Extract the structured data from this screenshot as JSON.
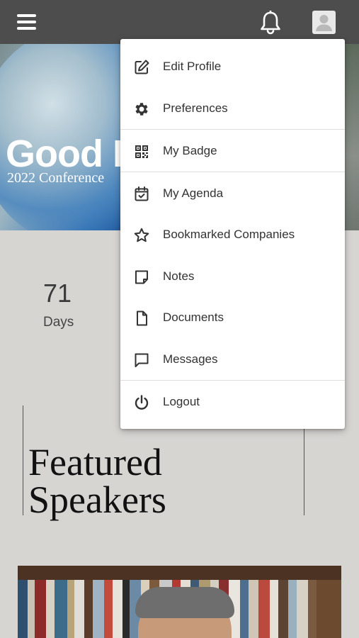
{
  "header": {
    "menu_icon": "hamburger-icon",
    "notification_icon": "bell-icon",
    "avatar_icon": "user-avatar-icon"
  },
  "hero": {
    "title": "Good F",
    "subtitle": "2022 Conference"
  },
  "countdown": {
    "value": "71",
    "unit": "Days"
  },
  "featured": {
    "title_line1": "Featured",
    "title_line2": "Speakers"
  },
  "dropdown": {
    "items": [
      {
        "label": "Edit Profile",
        "icon": "edit-icon"
      },
      {
        "label": "Preferences",
        "icon": "gear-icon"
      },
      {
        "label": "My Badge",
        "icon": "qr-code-icon"
      },
      {
        "label": "My Agenda",
        "icon": "calendar-check-icon"
      },
      {
        "label": "Bookmarked Companies",
        "icon": "star-icon"
      },
      {
        "label": "Notes",
        "icon": "note-icon"
      },
      {
        "label": "Documents",
        "icon": "document-icon"
      },
      {
        "label": "Messages",
        "icon": "message-icon"
      },
      {
        "label": "Logout",
        "icon": "power-icon"
      }
    ]
  },
  "colors": {
    "topbar": "#4d4d4d",
    "page_background": "#d6d5d2",
    "menu_background": "#ffffff",
    "icon_color": "#333333"
  }
}
